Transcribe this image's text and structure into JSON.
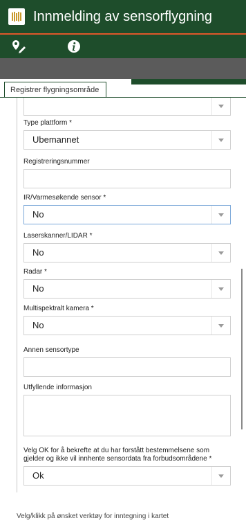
{
  "app": {
    "title": "Innmelding av sensorflygning"
  },
  "toolbar": {
    "draw_icon": "draw-pin-icon",
    "info_icon": "info-icon"
  },
  "tab": {
    "label": "Registrer flygningsområde"
  },
  "form": {
    "type_plattform": {
      "label": "Type plattform *",
      "value": "Ubemannet"
    },
    "registreringsnummer": {
      "label": "Registreringsnummer",
      "value": ""
    },
    "ir_sensor": {
      "label": "IR/Varmesøkende sensor *",
      "value": "No"
    },
    "lidar": {
      "label": "Laserskanner/LIDAR *",
      "value": "No"
    },
    "radar": {
      "label": "Radar *",
      "value": "No"
    },
    "multispektralt": {
      "label": "Multispektralt kamera *",
      "value": "No"
    },
    "annen_sensortype": {
      "label": "Annen sensortype",
      "value": ""
    },
    "utfyllende": {
      "label": "Utfyllende informasjon",
      "value": ""
    },
    "bekreft": {
      "label": "Velg OK for å bekrefte at du har forstått bestemmelsene som gjelder og ikke vil innhente sensordata fra forbudsområdene *",
      "value": "Ok"
    }
  },
  "footer": {
    "text": "Velg/klikk på ønsket verktøy for inntegning i kartet"
  }
}
